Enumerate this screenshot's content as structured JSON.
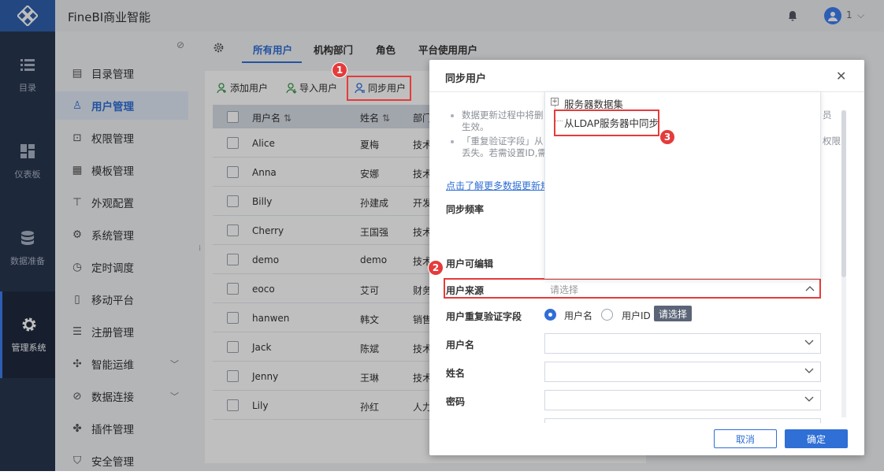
{
  "app": {
    "title": "FineBI商业智能",
    "user_count": "1"
  },
  "leftnav": [
    {
      "label": "目录",
      "icon": "list-icon"
    },
    {
      "label": "仪表板",
      "icon": "dashboard-icon"
    },
    {
      "label": "数据准备",
      "icon": "database-icon"
    },
    {
      "label": "管理系统",
      "icon": "gear-icon",
      "active": true
    }
  ],
  "sidemenu": [
    {
      "label": "目录管理",
      "icon": "catalog-icon"
    },
    {
      "label": "用户管理",
      "icon": "user-icon",
      "active": true
    },
    {
      "label": "权限管理",
      "icon": "lock-icon"
    },
    {
      "label": "模板管理",
      "icon": "template-icon"
    },
    {
      "label": "外观配置",
      "icon": "paint-icon"
    },
    {
      "label": "系统管理",
      "icon": "settings-icon"
    },
    {
      "label": "定时调度",
      "icon": "timer-icon"
    },
    {
      "label": "移动平台",
      "icon": "mobile-icon"
    },
    {
      "label": "注册管理",
      "icon": "register-icon"
    },
    {
      "label": "智能运维",
      "icon": "ops-icon",
      "expandable": true
    },
    {
      "label": "数据连接",
      "icon": "link-icon",
      "expandable": true
    },
    {
      "label": "插件管理",
      "icon": "plugin-icon"
    },
    {
      "label": "安全管理",
      "icon": "shield-icon"
    }
  ],
  "tabs": [
    "所有用户",
    "机构部门",
    "角色",
    "平台使用用户"
  ],
  "toolbar": {
    "add": "添加用户",
    "import": "导入用户",
    "sync": "同步用户"
  },
  "table": {
    "headers": [
      "用户名",
      "姓名",
      "部门"
    ],
    "rows": [
      [
        "Alice",
        "夏梅",
        "技术"
      ],
      [
        "Anna",
        "安娜",
        "技术"
      ],
      [
        "Billy",
        "孙建成",
        "开发"
      ],
      [
        "Cherry",
        "王国强",
        "技术"
      ],
      [
        "demo",
        "demo",
        "技术"
      ],
      [
        "eoco",
        "艾可",
        "财务"
      ],
      [
        "hanwen",
        "韩文",
        "销售"
      ],
      [
        "Jack",
        "陈斌",
        "技术"
      ],
      [
        "Jenny",
        "王琳",
        "技术"
      ],
      [
        "Lily",
        "孙红",
        "人力"
      ]
    ]
  },
  "badges": [
    "1",
    "2",
    "3"
  ],
  "dialog": {
    "title": "同步用户",
    "notes": [
      [
        "数据更新过程中将删",
        "生效。"
      ],
      [
        "「重复验证字段」从",
        "丢失。若需设置ID,需"
      ]
    ],
    "notes_right": [
      "员",
      "权限"
    ],
    "learn_more": "点击了解更多数据更新规",
    "labels": {
      "freq": "同步频率",
      "editable": "用户可编辑",
      "source": "用户来源",
      "dup_field": "用户重复验证字段",
      "username": "用户名",
      "name": "姓名",
      "password": "密码"
    },
    "source_placeholder": "请选择",
    "radio_options": [
      "用户名",
      "用户ID"
    ],
    "tooltip": "请选择",
    "cancel": "取消",
    "ok": "确定"
  },
  "dropdown": [
    "服务器数据集",
    "从LDAP服务器中同步"
  ],
  "colors": {
    "accent": "#2f6fd6",
    "highlight": "#e53b3b",
    "nav": "#29364f"
  }
}
